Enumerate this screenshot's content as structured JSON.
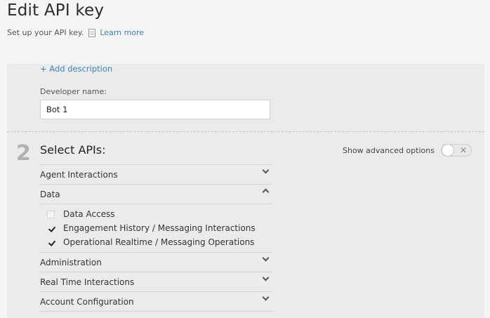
{
  "header": {
    "title": "Edit API key",
    "subtitle": "Set up your API key.",
    "learn_more": "Learn more"
  },
  "form": {
    "add_description": "+ Add description",
    "developer_label": "Developer name:",
    "developer_value": "Bot 1"
  },
  "apis_section": {
    "step": "2",
    "title": "Select APIs:",
    "advanced_label": "Show advanced options",
    "advanced_enabled": false,
    "toggle_icon": "close-icon",
    "groups": [
      {
        "label": "Agent Interactions",
        "expanded": false
      },
      {
        "label": "Data",
        "expanded": true
      },
      {
        "label": "Administration",
        "expanded": false
      },
      {
        "label": "Real Time Interactions",
        "expanded": false
      },
      {
        "label": "Account Configuration",
        "expanded": false
      }
    ],
    "data_items": [
      {
        "label": "Data Access",
        "checked": false
      },
      {
        "label": "Engagement History / Messaging Interactions",
        "checked": true
      },
      {
        "label": "Operational Realtime / Messaging Operations",
        "checked": true
      }
    ]
  },
  "colors": {
    "link": "#3a84b8",
    "page_bg": "#f5f5f4",
    "card_bg": "#ebebeb"
  }
}
